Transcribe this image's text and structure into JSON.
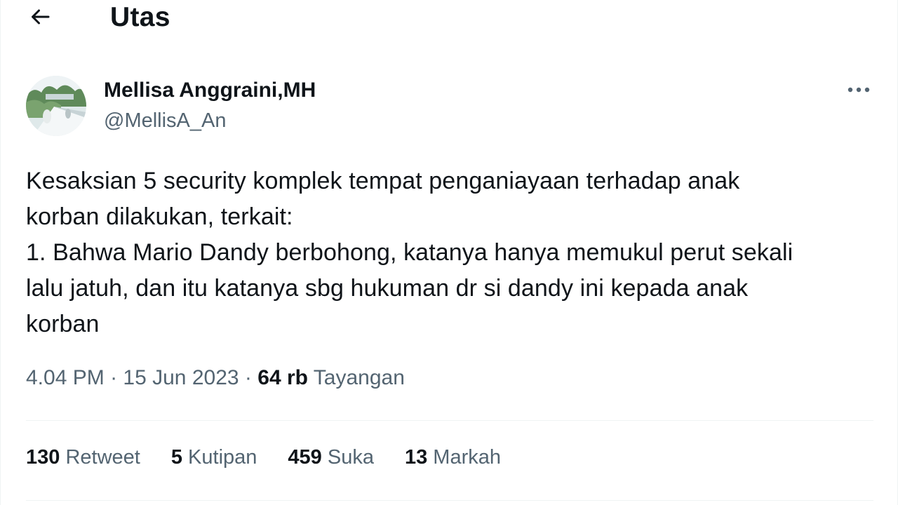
{
  "header": {
    "title": "Utas",
    "back_icon": "arrow-left-icon"
  },
  "author": {
    "name": "Mellisa Anggraini,MH",
    "handle": "@MellisA_An",
    "more_icon": "more-horizontal-icon"
  },
  "tweet": {
    "text": "Kesaksian 5 security komplek tempat penganiayaan terhadap anak\nkorban dilakukan, terkait:\n1. Bahwa Mario Dandy berbohong, katanya hanya memukul perut sekali\nlalu jatuh, dan itu katanya sbg hukuman dr si dandy ini kepada anak\nkorban"
  },
  "meta": {
    "time": "4.04 PM",
    "separator": "·",
    "date": "15 Jun 2023",
    "views_count": "64 rb",
    "views_label": "Tayangan"
  },
  "stats": [
    {
      "count": "130",
      "label": "Retweet"
    },
    {
      "count": "5",
      "label": "Kutipan"
    },
    {
      "count": "459",
      "label": "Suka"
    },
    {
      "count": "13",
      "label": "Markah"
    }
  ],
  "colors": {
    "text_primary": "#0f1419",
    "text_secondary": "#536471",
    "divider": "#eff3f4"
  }
}
